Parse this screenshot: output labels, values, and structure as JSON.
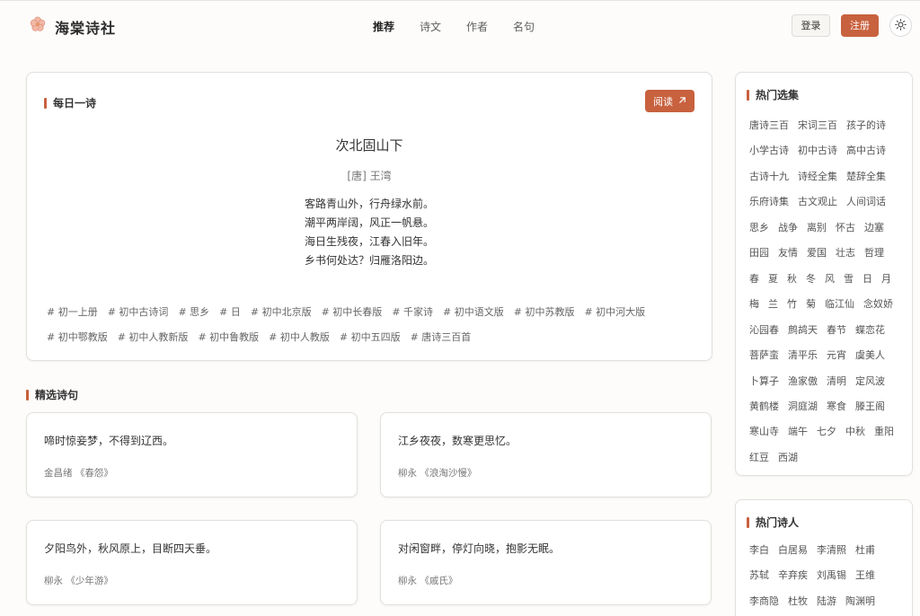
{
  "header": {
    "brand": "海棠诗社",
    "nav": [
      "推荐",
      "诗文",
      "作者",
      "名句"
    ],
    "login": "登录",
    "register": "注册"
  },
  "daily": {
    "heading": "每日一诗",
    "read_button": "阅读",
    "title": "次北固山下",
    "author": "[唐]  王湾",
    "lines": [
      "客路青山外，行舟绿水前。",
      "潮平两岸阔，风正一帆悬。",
      "海日生残夜，江春入旧年。",
      "乡书何处达？归雁洛阳边。"
    ],
    "tags": [
      "# 初一上册",
      "# 初中古诗词",
      "# 思乡",
      "# 日",
      "# 初中北京版",
      "# 初中长春版",
      "# 千家诗",
      "# 初中语文版",
      "# 初中苏教版",
      "# 初中河大版",
      "# 初中鄂教版",
      "# 初中人教新版",
      "# 初中鲁教版",
      "# 初中人教版",
      "# 初中五四版",
      "# 唐诗三百首"
    ]
  },
  "quotes": {
    "heading": "精选诗句",
    "items": [
      {
        "text": "啼时惊妾梦，不得到辽西。",
        "source": "金昌绪 《春怨》"
      },
      {
        "text": "江乡夜夜，数寒更思忆。",
        "source": "柳永 《浪淘沙慢》"
      },
      {
        "text": "夕阳鸟外，秋风原上，目断四天垂。",
        "source": "柳永 《少年游》"
      },
      {
        "text": "对闲窗畔，停灯向晓，抱影无眠。",
        "source": "柳永 《戚氏》"
      }
    ]
  },
  "sidebar_collections": {
    "heading": "热门选集",
    "items": [
      "唐诗三百",
      "宋词三百",
      "孩子的诗",
      "小学古诗",
      "初中古诗",
      "高中古诗",
      "古诗十九",
      "诗经全集",
      "楚辞全集",
      "乐府诗集",
      "古文观止",
      "人间词话",
      "思乡",
      "战争",
      "离别",
      "怀古",
      "边塞",
      "田园",
      "友情",
      "爱国",
      "壮志",
      "哲理",
      "春",
      "夏",
      "秋",
      "冬",
      "风",
      "雪",
      "日",
      "月",
      "梅",
      "兰",
      "竹",
      "菊",
      "临江仙",
      "念奴娇",
      "沁园春",
      "鹧鸪天",
      "春节",
      "蝶恋花",
      "菩萨蛮",
      "清平乐",
      "元宵",
      "虞美人",
      "卜算子",
      "渔家傲",
      "清明",
      "定风波",
      "黄鹤楼",
      "洞庭湖",
      "寒食",
      "滕王阁",
      "寒山寺",
      "端午",
      "七夕",
      "中秋",
      "重阳",
      "红豆",
      "西湖"
    ]
  },
  "sidebar_poets": {
    "heading": "热门诗人",
    "items": [
      "李白",
      "白居易",
      "李清照",
      "杜甫",
      "苏轼",
      "辛弃疾",
      "刘禹锡",
      "王维",
      "李商隐",
      "杜牧",
      "陆游",
      "陶渊明"
    ]
  },
  "colors": {
    "accent": "#c8613e",
    "border": "#e2e0dc",
    "background": "#fdfcfb"
  },
  "icons": {
    "logo": "begonia-flower-icon",
    "theme": "sun-icon",
    "read": "arrow-up-right-icon"
  }
}
